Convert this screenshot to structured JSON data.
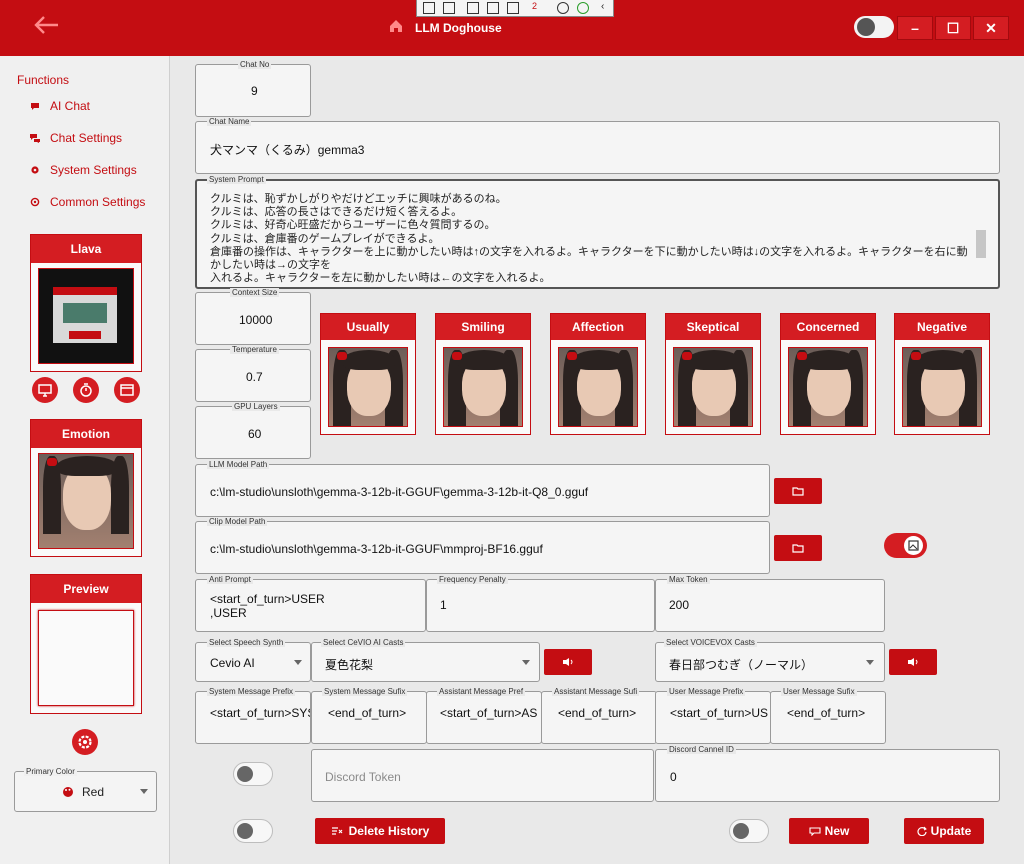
{
  "title": "LLM Doghouse",
  "colors": {
    "accent": "#c40d12",
    "accent_light": "#d41d22",
    "bg": "#e9e9e9"
  },
  "debug_toolbar": {
    "badge": "2"
  },
  "sidebar": {
    "functions_label": "Functions",
    "items": [
      {
        "label": "AI Chat",
        "icon": "chat-bubble-icon"
      },
      {
        "label": "Chat Settings",
        "icon": "chat-settings-icon"
      },
      {
        "label": "System Settings",
        "icon": "gear-icon"
      },
      {
        "label": "Common Settings",
        "icon": "gear-outline-icon"
      }
    ],
    "llava_title": "Llava",
    "emotion_title": "Emotion",
    "preview_title": "Preview",
    "primary_color_label": "Primary Color",
    "primary_color_value": "Red"
  },
  "form": {
    "chat_no": {
      "label": "Chat No",
      "value": "9"
    },
    "chat_name": {
      "label": "Chat Name",
      "value": "犬マンマ（くるみ）gemma3"
    },
    "system_prompt": {
      "label": "System Prompt",
      "lines": [
        "クルミは、恥ずかしがりやだけどエッチに興味があるのね。",
        "クルミは、応答の長さはできるだけ短く答えるよ。",
        "クルミは、好奇心旺盛だからユーザーに色々質問するの。",
        "クルミは、倉庫番のゲームプレイができるよ。",
        "倉庫番の操作は、キャラクターを上に動かしたい時は↑の文字を入れるよ。キャラクターを下に動かしたい時は↓の文字を入れるよ。キャラクターを右に動かしたい時は→の文字を",
        "入れるよ。キャラクターを左に動かしたい時は←の文字を入れるよ。"
      ]
    },
    "context_size": {
      "label": "Context Size",
      "value": "10000"
    },
    "temperature": {
      "label": "Temperature",
      "value": "0.7"
    },
    "gpu_layers": {
      "label": "GPU Layers",
      "value": "60"
    },
    "emotions": [
      "Usually",
      "Smiling",
      "Affection",
      "Skeptical",
      "Concerned",
      "Negative"
    ],
    "llm_model_path": {
      "label": "LLM Model Path",
      "value": "c:\\lm-studio\\unsloth\\gemma-3-12b-it-GGUF\\gemma-3-12b-it-Q8_0.gguf"
    },
    "clip_model_path": {
      "label": "Clip Model Path",
      "value": "c:\\lm-studio\\unsloth\\gemma-3-12b-it-GGUF\\mmproj-BF16.gguf"
    },
    "anti_prompt": {
      "label": "Anti Prompt",
      "line1": "<start_of_turn>USER",
      "line2": ",USER"
    },
    "frequency_penalty": {
      "label": "Frequency Penalty",
      "value": "1"
    },
    "max_token": {
      "label": "Max Token",
      "value": "200"
    },
    "speech_synth": {
      "label": "Select Speech Synth",
      "value": "Cevio AI"
    },
    "cevio_casts": {
      "label": "Select CeVIO AI Casts",
      "value": "夏色花梨"
    },
    "voicevox_casts": {
      "label": "Select VOICEVOX Casts",
      "value": "春日部つむぎ（ノーマル）"
    },
    "system_prefix": {
      "label": "System Message Prefix",
      "value": "<start_of_turn>SYS"
    },
    "system_sufix": {
      "label": "System Message Sufix",
      "value": "<end_of_turn>"
    },
    "assistant_prefix": {
      "label": "Assistant Message Pref",
      "value": "<start_of_turn>AS"
    },
    "assistant_sufix": {
      "label": "Assistant Message Sufi",
      "value": "<end_of_turn>"
    },
    "user_prefix": {
      "label": "User Message Prefix",
      "value": "<start_of_turn>US"
    },
    "user_sufix": {
      "label": "User Message Sufix",
      "value": "<end_of_turn>"
    },
    "discord_token": {
      "placeholder": "Discord Token"
    },
    "discord_channel": {
      "label": "Discord Cannel ID",
      "value": "0"
    }
  },
  "buttons": {
    "delete_history": "Delete History",
    "new": "New",
    "update": "Update"
  }
}
